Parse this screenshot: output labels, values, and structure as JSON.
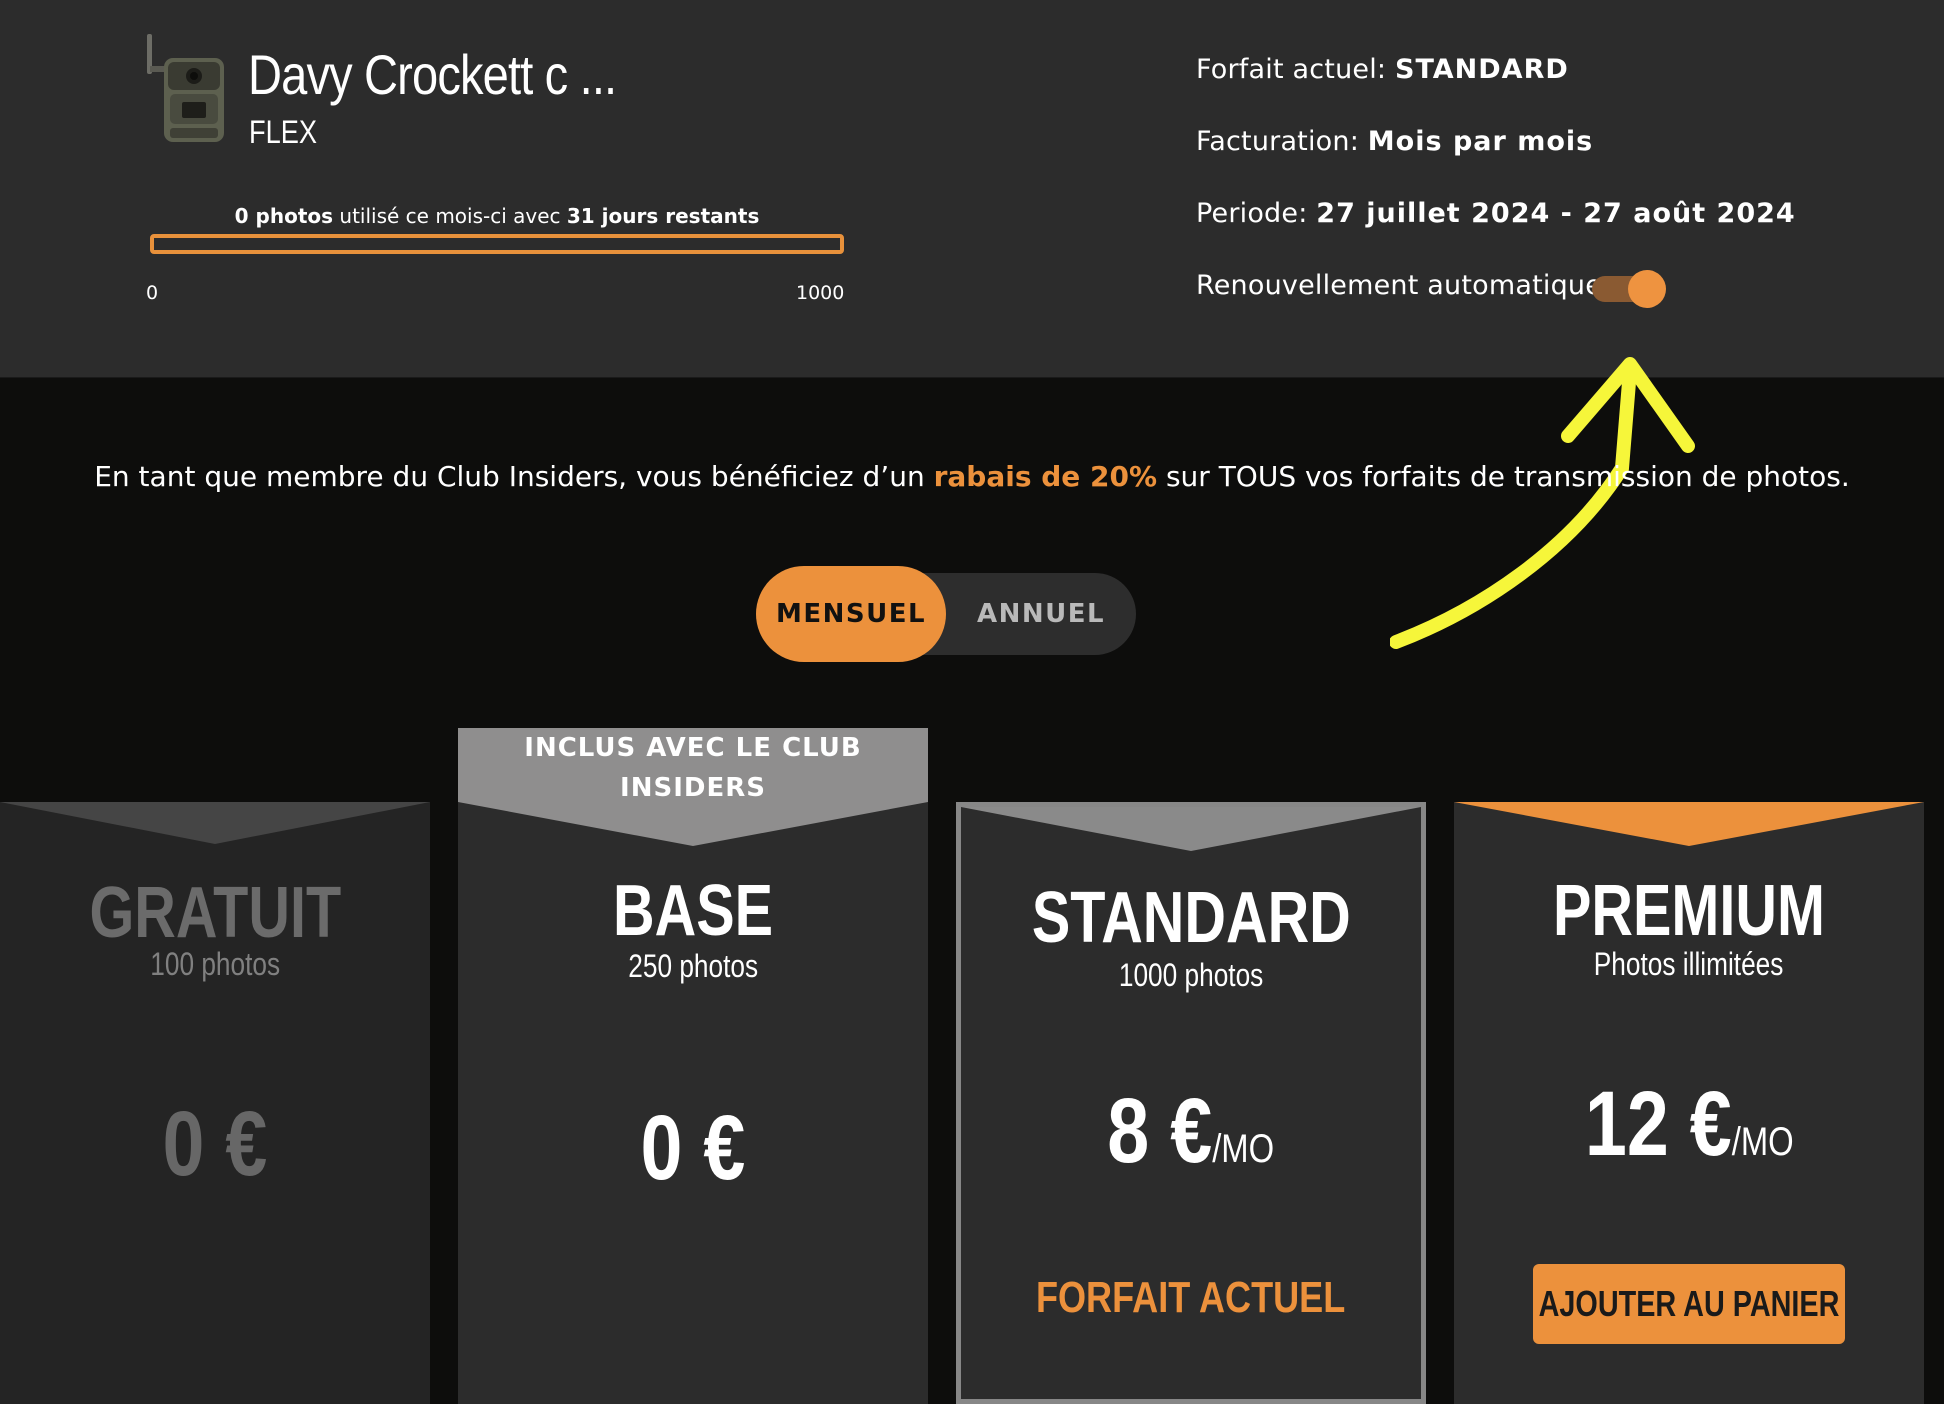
{
  "device": {
    "name": "Davy Crockett c ...",
    "model": "FLEX"
  },
  "usage": {
    "used_count": "0 photos",
    "used_middle": " utilisé ce mois-ci avec ",
    "days_left": "31 jours restants",
    "min_label": "0",
    "max_label": "1000",
    "fill_fraction": 0.0
  },
  "plan_info": {
    "current_label": "Forfait actuel: ",
    "current_value": "STANDARD",
    "billing_label": "Facturation: ",
    "billing_value": "Mois par mois",
    "period_label": "Periode: ",
    "period_value": "27 juillet 2024 - 27 août 2024",
    "renew_label": "Renouvellement automatique",
    "renew_on": true
  },
  "promo": {
    "prefix": "En tant que membre du Club Insiders, vous bénéficiez d’un ",
    "highlight": "rabais de 20%",
    "suffix": " sur TOUS vos forfaits de transmission de photos."
  },
  "billing_switch": {
    "monthly": "MENSUEL",
    "yearly": "ANNUEL",
    "selected": "monthly"
  },
  "plans": {
    "free": {
      "name": "GRATUIT",
      "photos": "100 photos",
      "price": "0 €"
    },
    "base": {
      "ribbon": "INCLUS AVEC LE CLUB INSIDERS",
      "name": "BASE",
      "photos": "250 photos",
      "price": "0 €"
    },
    "standard": {
      "name": "STANDARD",
      "photos": "1000 photos",
      "price": "8 €",
      "unit": "/MO",
      "status": "FORFAIT ACTUEL"
    },
    "premium": {
      "name": "PREMIUM",
      "photos": "Photos illimitées",
      "price": "12 €",
      "unit": "/MO",
      "button": "AJOUTER AU PANIER"
    }
  },
  "colors": {
    "accent": "#ec913c",
    "panel": "#2c2c2c",
    "background": "#0d0d0c",
    "annotation_arrow": "#f6f63a"
  }
}
